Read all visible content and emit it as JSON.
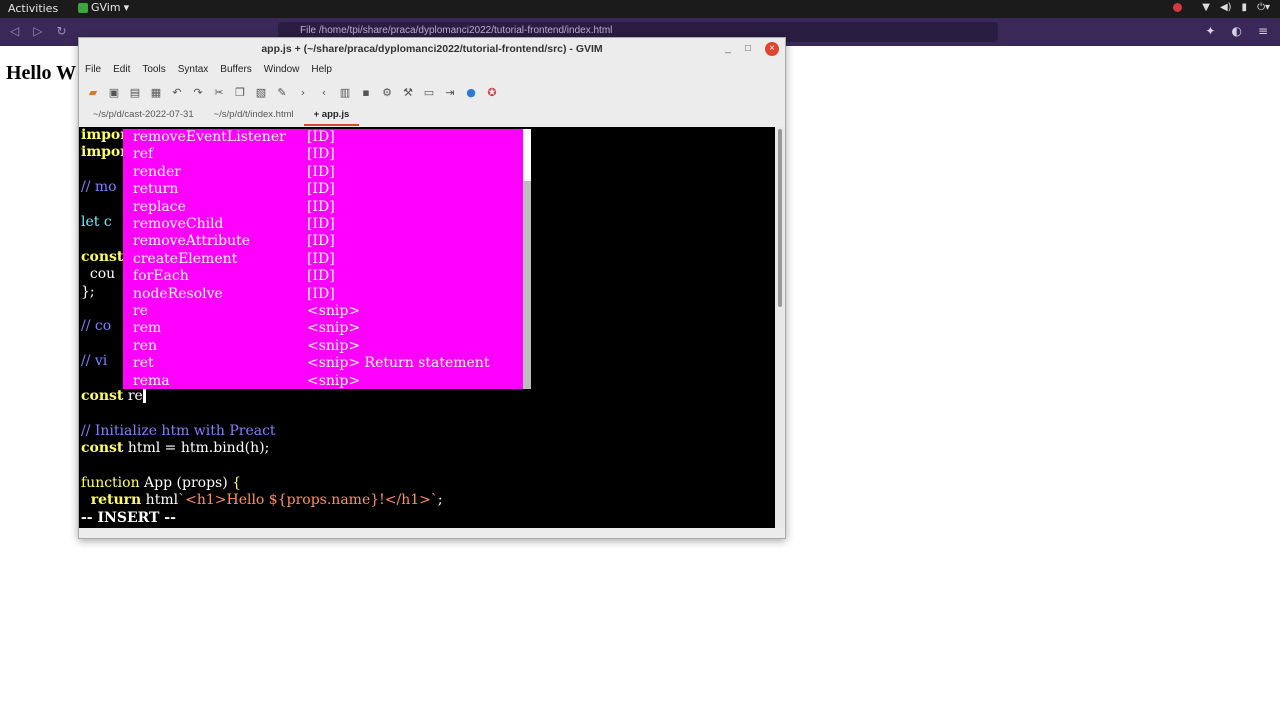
{
  "topbar": {
    "activities": "Activities",
    "app_name": "GVim",
    "app_menu_arrow": "▾"
  },
  "browser": {
    "url": "File  /home/tpi/share/praca/dyplomanci2022/tutorial-frontend/index.html",
    "page_heading": "Hello W"
  },
  "window": {
    "title": "app.js + (~/share/praca/dyplomanci2022/tutorial-frontend/src) - GVIM"
  },
  "menu": [
    "File",
    "Edit",
    "Tools",
    "Syntax",
    "Buffers",
    "Window",
    "Help"
  ],
  "tabs": [
    {
      "label": "~/s/p/d/cast-2022-07-31",
      "active": false
    },
    {
      "label": "~/s/p/d/t/index.html",
      "active": false
    },
    {
      "label": "+ app.js",
      "active": true
    }
  ],
  "code": {
    "l1": "impor",
    "l2": "impor",
    "l4": "// mo",
    "l6a": "let c",
    "l8": "const",
    "l9": "  cou",
    "l10": "};",
    "l12": "// co",
    "l14": "// vi",
    "l16_kw": "const",
    "l16_rest": " re",
    "l18": "// Initialize htm with Preact",
    "l19_kw": "const",
    "l19_rest": " html = htm.bind(h);",
    "l21_kw": "function",
    "l21_fn": " App",
    "l21_rest": " (props) ",
    "l21_brace": "{",
    "l22_kw": "  return",
    "l22_plain": " html",
    "l22_str": "`<h1>Hello ${props.name}!</h1>`",
    "l22_end": ";",
    "mode": "-- INSERT --"
  },
  "completion": [
    {
      "word": "removeEventListener",
      "kind": "[ID]"
    },
    {
      "word": "ref",
      "kind": "[ID]"
    },
    {
      "word": "render",
      "kind": "[ID]"
    },
    {
      "word": "return",
      "kind": "[ID]"
    },
    {
      "word": "replace",
      "kind": "[ID]"
    },
    {
      "word": "removeChild",
      "kind": "[ID]"
    },
    {
      "word": "removeAttribute",
      "kind": "[ID]"
    },
    {
      "word": "createElement",
      "kind": "[ID]"
    },
    {
      "word": "forEach",
      "kind": "[ID]"
    },
    {
      "word": "nodeResolve",
      "kind": "[ID]"
    },
    {
      "word": "re",
      "kind": "<snip>"
    },
    {
      "word": "rem",
      "kind": "<snip>"
    },
    {
      "word": "ren",
      "kind": "<snip>"
    },
    {
      "word": "ret",
      "kind": "<snip> Return statement"
    },
    {
      "word": "rema",
      "kind": "<snip>"
    }
  ],
  "colors": {
    "popup_bg": "#ff00ff",
    "editor_bg": "#000000",
    "keyword": "#ffff60",
    "comment": "#8080ff",
    "string": "#ff9060"
  }
}
